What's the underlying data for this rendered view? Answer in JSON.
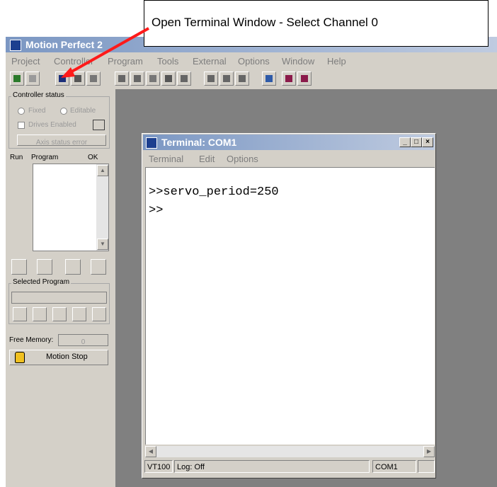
{
  "app": {
    "title": "Motion Perfect 2",
    "menu": [
      "Project",
      "Controller",
      "Program",
      "Tools",
      "External",
      "Options",
      "Window",
      "Help"
    ]
  },
  "callout": {
    "text": "Open Terminal Window - Select Channel 0"
  },
  "left_panel": {
    "controller_status": {
      "label": "Controller status",
      "fixed_label": "Fixed",
      "editable_label": "Editable",
      "drives_enabled_label": "Drives Enabled",
      "axis_status_button": "Axis status error"
    },
    "program_list": {
      "col_run": "Run",
      "col_program": "Program",
      "col_ok": "OK"
    },
    "selected_program": {
      "label": "Selected Program",
      "value": ""
    },
    "free_memory": {
      "label": "Free Memory:",
      "value": "0"
    },
    "motion_stop_button": "Motion Stop"
  },
  "terminal": {
    "title": "Terminal: COM1",
    "menu": [
      "Terminal",
      "Edit",
      "Options"
    ],
    "lines": [
      ">>servo_period=250",
      ">>"
    ],
    "status": {
      "emulation": "VT100",
      "log": "Log: Off",
      "port": "COM1"
    }
  },
  "colors": {
    "annotation_arrow": "#ff1a1a",
    "titlebar_start": "#7b97c3",
    "workspace": "#808080"
  }
}
